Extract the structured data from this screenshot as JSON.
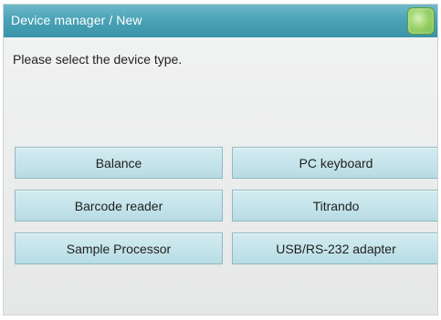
{
  "window": {
    "title": "Device manager / New"
  },
  "main": {
    "prompt": "Please select the device type."
  },
  "device_types": {
    "balance": "Balance",
    "barcode_reader": "Barcode reader",
    "sample_processor": "Sample Processor",
    "pc_keyboard": "PC keyboard",
    "titrando": "Titrando",
    "usb_rs232_adapter": "USB/RS-232 adapter"
  },
  "icons": {
    "help": "help-icon"
  },
  "colors": {
    "titlebar": "#4aa3b6",
    "button": "#c3e3ea",
    "help_button": "#9bd26a"
  }
}
